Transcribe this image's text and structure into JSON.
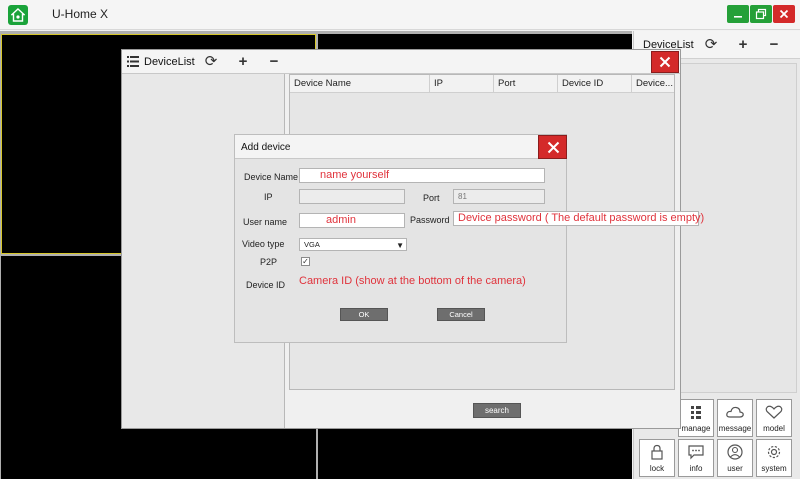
{
  "app": {
    "title": "U-Home X"
  },
  "right_panel": {
    "title": "DeviceList",
    "tiles": [
      {
        "label": "manage",
        "icon": "grid-list-icon"
      },
      {
        "label": "message",
        "icon": "cloud-icon"
      },
      {
        "label": "model",
        "icon": "heart-icon"
      },
      {
        "label": "lock",
        "icon": "lock-icon"
      },
      {
        "label": "info",
        "icon": "chat-icon"
      },
      {
        "label": "user",
        "icon": "user-icon"
      },
      {
        "label": "system",
        "icon": "gear-icon"
      }
    ]
  },
  "device_list_window": {
    "title": "DeviceList",
    "columns": [
      "Device Name",
      "IP",
      "Port",
      "Device ID",
      "Device..."
    ],
    "search_label": "search"
  },
  "add_device_dialog": {
    "title": "Add device",
    "labels": {
      "device_name": "Device Name",
      "ip": "IP",
      "port": "Port",
      "user_name": "User name",
      "password": "Password",
      "video_type": "Video type",
      "p2p": "P2P",
      "device_id": "Device ID"
    },
    "values": {
      "device_name": "name yourself",
      "ip": "",
      "port": "81",
      "user_name": "admin",
      "password": "Device password ( The default password is empty)",
      "video_type": "VGA",
      "p2p_checked": true,
      "device_id": "Camera ID (show at the bottom of the camera)"
    },
    "ok_label": "OK",
    "cancel_label": "Cancel"
  },
  "colors": {
    "accent_green": "#1aa33a",
    "close_red": "#d42a2a",
    "annotation_red": "#e0333c",
    "selected_cell_border": "#d7c72a"
  }
}
